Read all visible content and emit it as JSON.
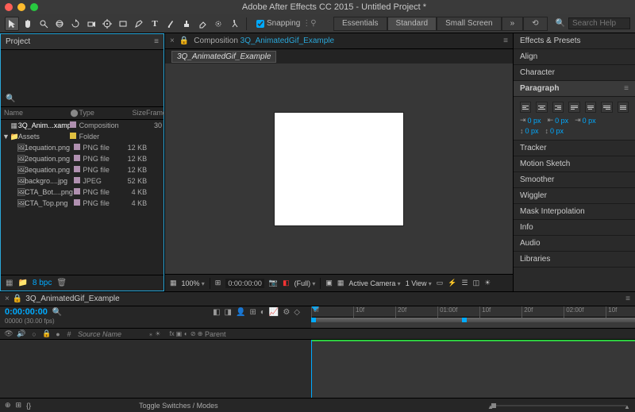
{
  "title": "Adobe After Effects CC 2015 - Untitled Project *",
  "toolbar": {
    "snapping_label": "Snapping",
    "workspaces": [
      "Essentials",
      "Standard",
      "Small Screen"
    ],
    "search_placeholder": "Search Help"
  },
  "project": {
    "panel_title": "Project",
    "columns": {
      "name": "Name",
      "type": "Type",
      "size": "Size",
      "frame": "Frame"
    },
    "items": [
      {
        "name": "3Q_Anim...xample",
        "tag": "#b090b0",
        "type": "Composition",
        "size": "",
        "frame": "30",
        "icon": "comp"
      },
      {
        "name": "Assets",
        "tag": "#e0c040",
        "type": "Folder",
        "size": "",
        "frame": "",
        "icon": "folder",
        "open": true
      },
      {
        "name": "1equation.png",
        "tag": "#b090b0",
        "type": "PNG file",
        "size": "12 KB",
        "frame": "",
        "icon": "img",
        "sub": true
      },
      {
        "name": "2equation.png",
        "tag": "#b090b0",
        "type": "PNG file",
        "size": "12 KB",
        "frame": "",
        "icon": "img",
        "sub": true
      },
      {
        "name": "3equation.png",
        "tag": "#b090b0",
        "type": "PNG file",
        "size": "12 KB",
        "frame": "",
        "icon": "img",
        "sub": true
      },
      {
        "name": "backgro....jpg",
        "tag": "#b090b0",
        "type": "JPEG",
        "size": "52 KB",
        "frame": "",
        "icon": "img",
        "sub": true
      },
      {
        "name": "CTA_Bot....png",
        "tag": "#b090b0",
        "type": "PNG file",
        "size": "4 KB",
        "frame": "",
        "icon": "img",
        "sub": true
      },
      {
        "name": "CTA_Top.png",
        "tag": "#b090b0",
        "type": "PNG file",
        "size": "4 KB",
        "frame": "",
        "icon": "img",
        "sub": true
      }
    ],
    "footer_bpc": "8 bpc"
  },
  "composition": {
    "crumb_label": "Composition",
    "crumb_name": "3Q_AnimatedGif_Example",
    "chip": "3Q_AnimatedGif_Example",
    "footer": {
      "zoom": "100%",
      "time": "0:00:00:00",
      "quality": "(Full)",
      "camera": "Active Camera",
      "views": "1 View"
    }
  },
  "right_panels": {
    "items": [
      "Effects & Presets",
      "Align",
      "Character",
      "Paragraph",
      "Tracker",
      "Motion Sketch",
      "Smoother",
      "Wiggler",
      "Mask Interpolation",
      "Info",
      "Audio",
      "Libraries"
    ],
    "paragraph": {
      "indent_left": "0 px",
      "indent_right": "0 px",
      "indent_first": "0 px",
      "space_before": "0 px",
      "space_after": "0 px"
    }
  },
  "timeline": {
    "tab": "3Q_AnimatedGif_Example",
    "timecode": "0:00:00:00",
    "meta": "00000 (30.00 fps)",
    "source_col": "Source Name",
    "parent_col": "Parent",
    "switches_hdr": [
      "⁎",
      "☀",
      "",
      "fx",
      "▣",
      "◐",
      "⊘",
      "⊕"
    ],
    "ruler_ticks": [
      "0f",
      "10f",
      "20f",
      "01:00f",
      "10f",
      "20f",
      "02:00f",
      "10f"
    ],
    "toggle": "Toggle Switches / Modes"
  }
}
